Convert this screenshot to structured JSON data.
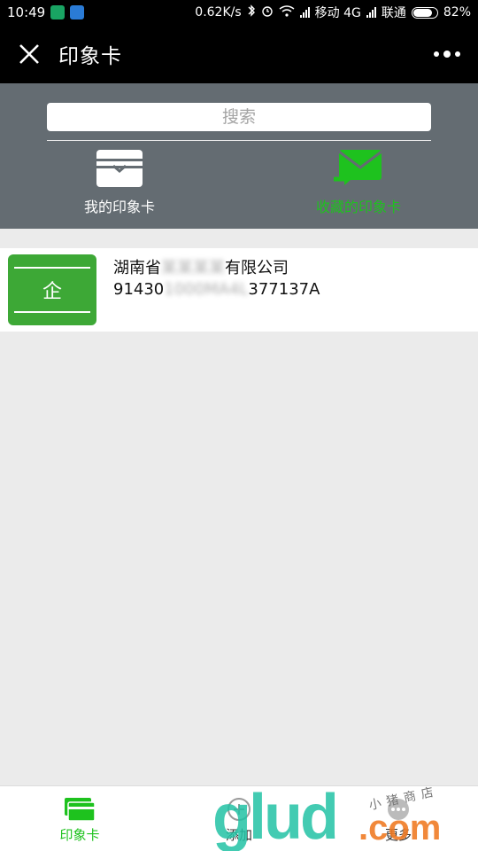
{
  "status_bar": {
    "time": "10:49",
    "network_speed": "0.62K/s",
    "carrier1": "移动 4G",
    "carrier2": "联通",
    "battery": "82%",
    "battery_level": 0.82
  },
  "title_bar": {
    "title": "印象卡"
  },
  "header": {
    "search_placeholder": "搜索",
    "tabs": [
      {
        "label": "我的印象卡",
        "icon": "card-box-icon"
      },
      {
        "label": "收藏的印象卡",
        "icon": "mail-arrow-icon"
      }
    ]
  },
  "list": {
    "items": [
      {
        "icon_text": "企",
        "name_prefix": "湖南省",
        "name_hidden": "某某某某",
        "name_suffix": "有限公司",
        "code_prefix": "91430",
        "code_hidden": "1000MA4L",
        "code_suffix": "377137A"
      }
    ]
  },
  "bottom_bar": {
    "tabs": [
      {
        "label": "印象卡",
        "icon": "cards-icon"
      },
      {
        "label": "添加",
        "icon": "add-icon"
      },
      {
        "label": "更多",
        "icon": "more-icon"
      }
    ]
  },
  "watermark": {
    "brand": "glud",
    "domain": ".com",
    "shop": "小猪商店"
  },
  "colors": {
    "accent": "#1ec21e",
    "header_bg": "#646c72",
    "card_green": "#3da836"
  }
}
